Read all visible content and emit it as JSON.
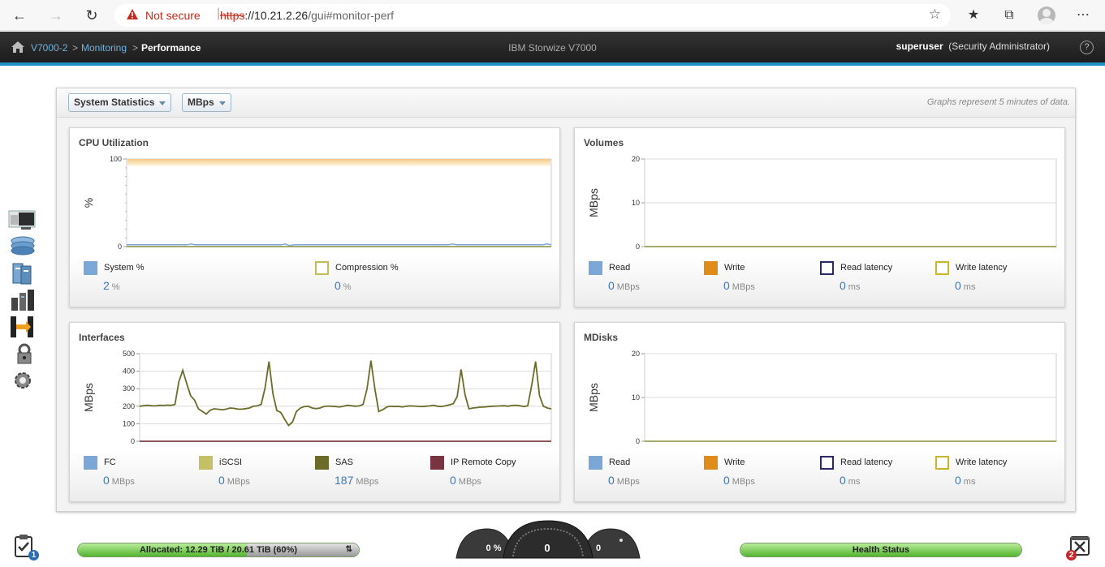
{
  "browser": {
    "security_label": "Not secure",
    "url_scheme": "https",
    "url_host": "://10.21.2.26",
    "url_rest": "/gui#monitor-perf"
  },
  "header": {
    "breadcrumb": [
      "V7000-2",
      "Monitoring",
      "Performance"
    ],
    "product": "IBM Storwize V7000",
    "user_name": "superuser",
    "user_role": "(Security Administrator)",
    "help": "?"
  },
  "toolbar": {
    "stats_select": "System Statistics",
    "unit_select": "MBps",
    "note": "Graphs represent 5 minutes of data."
  },
  "cpu": {
    "title": "CPU Utilization",
    "ylabel": "%",
    "legend": [
      {
        "label": "System %",
        "value": "2",
        "unit": "%",
        "color": "#7ba7d7"
      },
      {
        "label": "Compression %",
        "value": "0",
        "unit": "%",
        "color": "#c8b95a"
      }
    ]
  },
  "volumes": {
    "title": "Volumes",
    "ylabel": "MBps",
    "legend": [
      {
        "label": "Read",
        "value": "0",
        "unit": "MBps",
        "color": "#7ba7d7"
      },
      {
        "label": "Write",
        "value": "0",
        "unit": "MBps",
        "color": "#e08c1a"
      },
      {
        "label": "Read latency",
        "value": "0",
        "unit": "ms",
        "color": "#2a2a6a"
      },
      {
        "label": "Write latency",
        "value": "0",
        "unit": "ms",
        "color": "#c8b52a"
      }
    ]
  },
  "interfaces": {
    "title": "Interfaces",
    "ylabel": "MBps",
    "legend": [
      {
        "label": "FC",
        "value": "0",
        "unit": "MBps",
        "color": "#7ba7d7"
      },
      {
        "label": "iSCSI",
        "value": "0",
        "unit": "MBps",
        "color": "#c4c065"
      },
      {
        "label": "SAS",
        "value": "187",
        "unit": "MBps",
        "color": "#6b6b2a"
      },
      {
        "label": "IP Remote Copy",
        "value": "0",
        "unit": "MBps",
        "color": "#7a3340"
      }
    ]
  },
  "mdisks": {
    "title": "MDisks",
    "ylabel": "MBps",
    "legend": [
      {
        "label": "Read",
        "value": "0",
        "unit": "MBps",
        "color": "#7ba7d7"
      },
      {
        "label": "Write",
        "value": "0",
        "unit": "MBps",
        "color": "#e08c1a"
      },
      {
        "label": "Read latency",
        "value": "0",
        "unit": "ms",
        "color": "#2a2a6a"
      },
      {
        "label": "Write latency",
        "value": "0",
        "unit": "ms",
        "color": "#c8b52a"
      }
    ]
  },
  "status": {
    "allocated": "Allocated: 12.29 TiB / 20.61 TiB (60%)",
    "allocated_fraction": 0.6,
    "gauge_left": "0 %",
    "gauge_center": "0",
    "gauge_right": "0",
    "health": "Health Status",
    "tasks_badge": "1",
    "alerts_badge": "2"
  },
  "chart_data": [
    {
      "type": "area",
      "title": "CPU Utilization",
      "ylabel": "%",
      "ylim": [
        0,
        100
      ],
      "yticks": [
        0,
        100
      ],
      "series": [
        {
          "name": "System %",
          "values": [
            2,
            2,
            2,
            2,
            2,
            2,
            2,
            2,
            2,
            2,
            2,
            2,
            2,
            2,
            2,
            3,
            2,
            2,
            2,
            2,
            2,
            2,
            2,
            2,
            2,
            2,
            2,
            2,
            2,
            2,
            2,
            2,
            2,
            2,
            2,
            2,
            2,
            3,
            1,
            2,
            2,
            2,
            2,
            2,
            2,
            2,
            2,
            2,
            2,
            2,
            2,
            2,
            2,
            2,
            2,
            2,
            2,
            2,
            2,
            2,
            2,
            2,
            2,
            2,
            2,
            2,
            2,
            2,
            2,
            2,
            2,
            2,
            2,
            2,
            2,
            2,
            3,
            2,
            2,
            2,
            2,
            2,
            2,
            2,
            2,
            2,
            2,
            2,
            2,
            2,
            2,
            2,
            2,
            2,
            2,
            2,
            2,
            2,
            3,
            2
          ]
        },
        {
          "name": "Compression %",
          "values": [
            0
          ]
        }
      ]
    },
    {
      "type": "line",
      "title": "Volumes",
      "ylabel": "MBps",
      "ylim": [
        0,
        20
      ],
      "yticks": [
        0,
        10,
        20
      ],
      "series": [
        {
          "name": "Read",
          "values": [
            0
          ]
        },
        {
          "name": "Write",
          "values": [
            0
          ]
        }
      ]
    },
    {
      "type": "line",
      "title": "Interfaces",
      "ylabel": "MBps",
      "ylim": [
        0,
        500
      ],
      "yticks": [
        0,
        100,
        200,
        300,
        400,
        500
      ],
      "series": [
        {
          "name": "SAS",
          "values": [
            200,
            203,
            205,
            203,
            202,
            205,
            204,
            206,
            205,
            210,
            340,
            405,
            330,
            260,
            235,
            185,
            170,
            155,
            178,
            185,
            183,
            180,
            183,
            190,
            188,
            184,
            183,
            186,
            190,
            200,
            202,
            210,
            305,
            455,
            270,
            175,
            165,
            125,
            90,
            110,
            170,
            190,
            198,
            200,
            190,
            186,
            190,
            198,
            201,
            200,
            198,
            196,
            200,
            205,
            203,
            200,
            202,
            210,
            300,
            460,
            300,
            170,
            180,
            195,
            200,
            198,
            199,
            196,
            200,
            202,
            201,
            199,
            198,
            200,
            202,
            205,
            200,
            198,
            203,
            208,
            215,
            255,
            410,
            265,
            185,
            190,
            192,
            195,
            196,
            198,
            200,
            201,
            202,
            203,
            200,
            204,
            205,
            203,
            198,
            202,
            320,
            455,
            260,
            200,
            190,
            185
          ]
        },
        {
          "name": "FC",
          "values": [
            0
          ]
        },
        {
          "name": "iSCSI",
          "values": [
            0
          ]
        },
        {
          "name": "IP Remote Copy",
          "values": [
            0
          ]
        }
      ]
    },
    {
      "type": "line",
      "title": "MDisks",
      "ylabel": "MBps",
      "ylim": [
        0,
        20
      ],
      "yticks": [
        0,
        10,
        20
      ],
      "series": [
        {
          "name": "Read",
          "values": [
            0
          ]
        },
        {
          "name": "Write",
          "values": [
            0
          ]
        }
      ]
    }
  ]
}
